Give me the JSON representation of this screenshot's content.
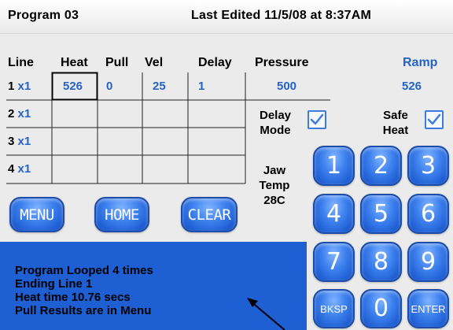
{
  "header": {
    "program": "Program 03",
    "last_edited": "Last Edited 11/5/08 at 8:37AM"
  },
  "table": {
    "headers": {
      "line": "Line",
      "heat": "Heat",
      "pull": "Pull",
      "vel": "Vel",
      "delay": "Delay",
      "pressure": "Pressure",
      "ramp": "Ramp"
    },
    "rows": [
      {
        "num": "1",
        "mult": "x1",
        "heat": "526",
        "pull": "0",
        "vel": "25",
        "delay": "1",
        "pressure": "500",
        "ramp": "526"
      },
      {
        "num": "2",
        "mult": "x1"
      },
      {
        "num": "3",
        "mult": "x1"
      },
      {
        "num": "4",
        "mult": "x1"
      }
    ]
  },
  "options": {
    "delay_mode_label": [
      "Delay",
      "Mode"
    ],
    "safe_heat_label": [
      "Safe",
      "Heat"
    ],
    "delay_mode_checked": true,
    "safe_heat_checked": true
  },
  "jaw_temp": {
    "label": [
      "Jaw",
      "Temp"
    ],
    "value": "28C"
  },
  "buttons": {
    "menu": "MENU",
    "home": "HOME",
    "clear": "CLEAR"
  },
  "keypad": {
    "keys": [
      "1",
      "2",
      "3",
      "4",
      "5",
      "6",
      "7",
      "8",
      "9"
    ],
    "bksp": "BKSP",
    "zero": "0",
    "enter": "ENTER"
  },
  "status": {
    "lines": [
      "Program Looped 4 times",
      "Ending Line 1",
      "Heat time 10.76 secs",
      "Pull Results are in Menu"
    ]
  },
  "colors": {
    "accent_blue": "#2563c7",
    "status_panel": "#1f5fd4",
    "background": "#ebebeb"
  }
}
